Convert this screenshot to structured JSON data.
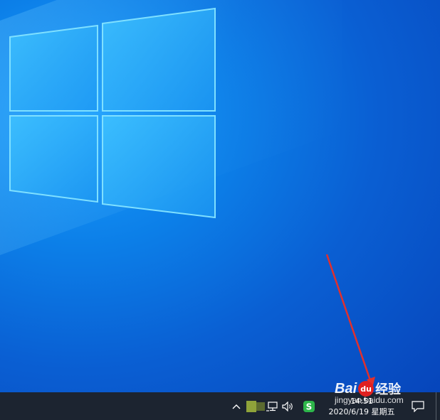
{
  "desktop": {
    "colors": {
      "accent": "#0a5fd3",
      "logo": "#27b2ff",
      "arrow": "#e0302e"
    }
  },
  "taskbar": {
    "tray": {
      "chevron_icon": "chevron-up-icon",
      "network_icon": "network-icon",
      "volume_icon": "volume-icon",
      "ime_icon": "sogou-ime-icon",
      "ime_label": "S"
    },
    "clock": {
      "time": "14:51",
      "date": "2020/6/19 星期五"
    },
    "notification_icon": "notification-icon"
  },
  "watermark": {
    "brand_text": "Bai",
    "brand_mark": "du",
    "brand_suffix": "经验",
    "url": "jingyan.baidu.com"
  }
}
